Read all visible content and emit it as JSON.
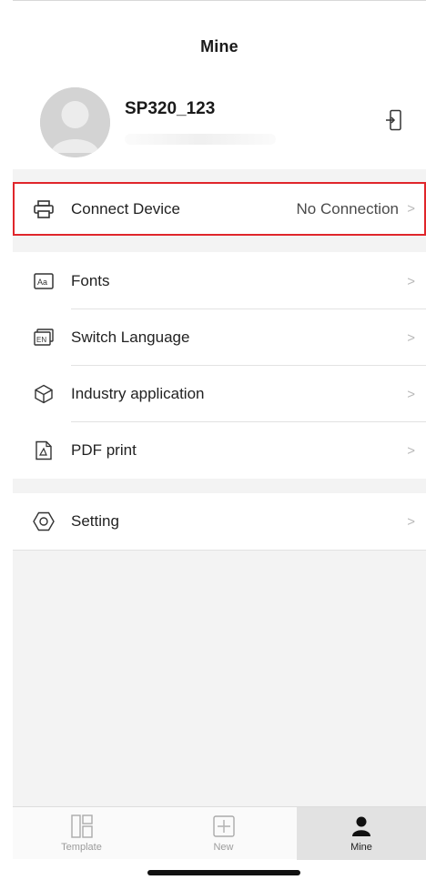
{
  "header": {
    "title": "Mine",
    "username": "SP320_123"
  },
  "device_row": {
    "label": "Connect Device",
    "value": "No Connection",
    "icon": "printer-icon"
  },
  "menu": [
    {
      "label": "Fonts",
      "icon": "fonts-icon"
    },
    {
      "label": "Switch Language",
      "icon": "language-icon"
    },
    {
      "label": "Industry application",
      "icon": "cube-icon"
    },
    {
      "label": "PDF print",
      "icon": "pdf-icon"
    }
  ],
  "settings": {
    "label": "Setting",
    "icon": "settings-icon"
  },
  "chevron": ">",
  "tabs": [
    {
      "label": "Template",
      "icon": "template-icon",
      "active": false
    },
    {
      "label": "New",
      "icon": "new-icon",
      "active": false
    },
    {
      "label": "Mine",
      "icon": "person-icon",
      "active": true
    }
  ],
  "colors": {
    "highlight": "#e0262b",
    "background": "#f4f4f4"
  }
}
